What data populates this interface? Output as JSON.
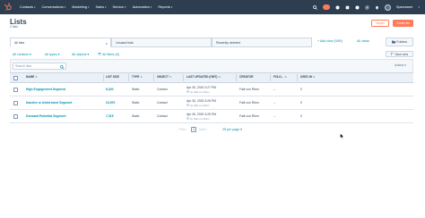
{
  "topnav": {
    "items": [
      {
        "label": "Contacts"
      },
      {
        "label": "Conversations"
      },
      {
        "label": "Marketing"
      },
      {
        "label": "Sales"
      },
      {
        "label": "Service"
      },
      {
        "label": "Automation"
      },
      {
        "label": "Reports"
      }
    ],
    "account_label": "Spacesaver"
  },
  "header": {
    "title": "Lists",
    "subtitle": "3 lists",
    "import_label": "Import",
    "create_label": "Create list"
  },
  "views": {
    "tabs": [
      {
        "label": "All lists"
      },
      {
        "label": "Unused lists"
      },
      {
        "label": "Recently deleted"
      }
    ],
    "add_view_label": "+ Add view (3/50)",
    "all_views_label": "All views",
    "folders_label": "Folders"
  },
  "filters": {
    "creators": "All creators",
    "types": "All types",
    "objects": "All objects",
    "advanced": "All filters (0)",
    "save_view": "Save view"
  },
  "table": {
    "search_placeholder": "Search lists",
    "actions_label": "Actions",
    "columns": [
      {
        "label": "NAME"
      },
      {
        "label": "LIST SIZE"
      },
      {
        "label": "TYPE"
      },
      {
        "label": "OBJECT"
      },
      {
        "label": "LAST UPDATED (GMT)"
      },
      {
        "label": "CREATOR"
      },
      {
        "label": "FOLD..."
      },
      {
        "label": "USED IN"
      }
    ],
    "rows": [
      {
        "name": "High Engagement Segment",
        "size": "8,320",
        "type": "Static",
        "object": "Contact",
        "updated": "Apr 30, 2020 3:27 PM",
        "updated_by": "by Falk von Rönn",
        "creator": "Falk von Rönn",
        "folder": "--",
        "used_in": "0"
      },
      {
        "name": "Inactive or Undersized Segment",
        "size": "24,570",
        "type": "Static",
        "object": "Contact",
        "updated": "Apr 30, 2020 3:26 PM",
        "updated_by": "by Falk von Rönn",
        "creator": "Falk von Rönn",
        "folder": "--",
        "used_in": "0"
      },
      {
        "name": "Dormant Potential Segment",
        "size": "7,015",
        "type": "Static",
        "object": "Contact",
        "updated": "Apr 30, 2020 3:25 PM",
        "updated_by": "by Falk von Rönn",
        "creator": "Falk von Rönn",
        "folder": "--",
        "used_in": "0"
      }
    ]
  },
  "pagination": {
    "prev_label": "Prev",
    "current_page": "1",
    "next_label": "Next",
    "per_page_label": "25 per page"
  },
  "colors": {
    "nav_bg": "#2d3e50",
    "accent": "#ff7a59",
    "link": "#0091ae",
    "text": "#33475b"
  }
}
